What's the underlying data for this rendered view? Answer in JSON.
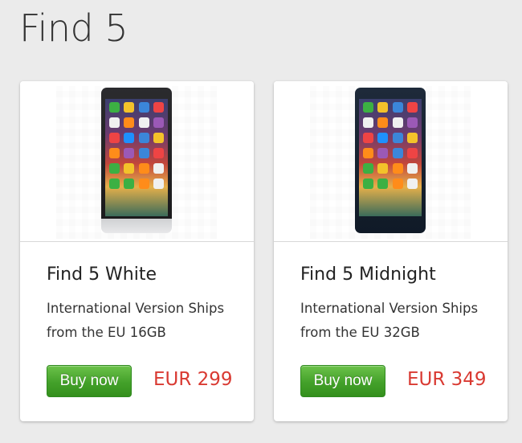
{
  "page": {
    "title": "Find 5"
  },
  "colors": {
    "accent_price": "#d93a32",
    "buy_button": "#43a12a",
    "background": "#ebebeb"
  },
  "products": [
    {
      "name": "Find 5 White",
      "description": "International Version Ships from the EU 16GB",
      "buy_label": "Buy now",
      "price": "EUR 299",
      "image": "phone-white-image"
    },
    {
      "name": "Find 5 Midnight",
      "description": "International Version Ships from the EU 32GB",
      "buy_label": "Buy now",
      "price": "EUR 349",
      "image": "phone-midnight-image"
    }
  ]
}
